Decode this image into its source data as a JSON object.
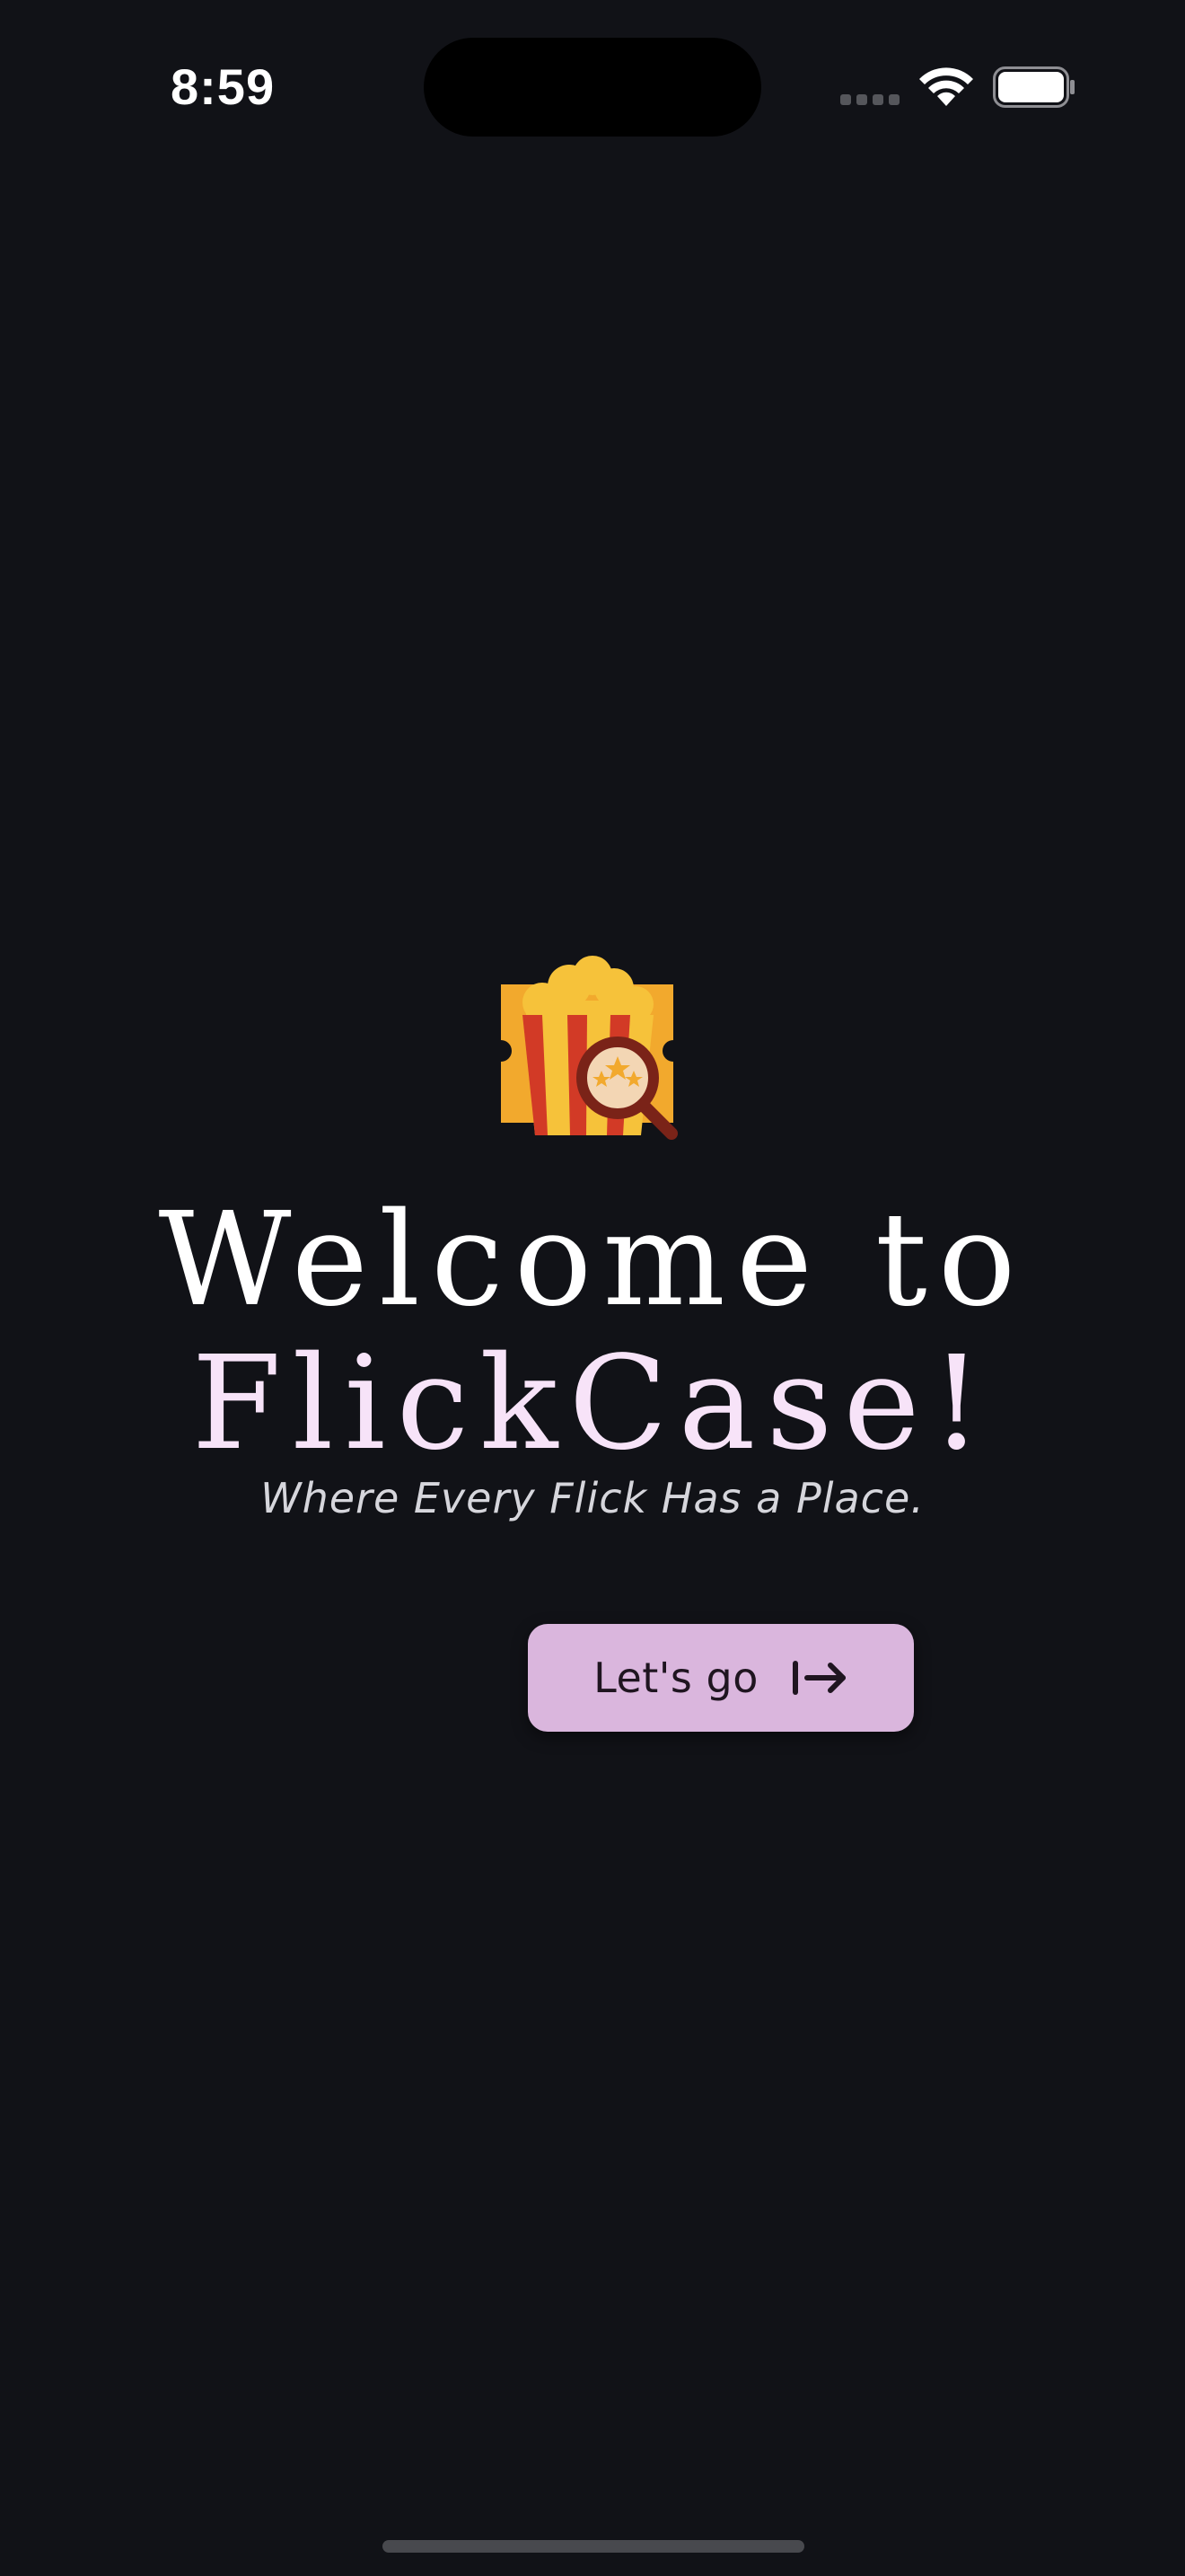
{
  "status_bar": {
    "time": "8:59",
    "icons": [
      "signal-icon",
      "wifi-icon",
      "battery-icon"
    ]
  },
  "welcome": {
    "line1": "Welcome to",
    "line2": "FlickCase!",
    "tagline": "Where Every Flick Has a Place."
  },
  "cta": {
    "label": "Let's go",
    "icon": "arrow-right-to-icon"
  },
  "colors": {
    "background": "#111217",
    "title": "#ffffff",
    "app_name": "#f7e3f8",
    "tagline": "#d6d6dc",
    "button_bg": "#dab6dd",
    "button_text": "#1f1520",
    "logo_ticket": "#f2a92d",
    "logo_popcorn": "#f6c23a",
    "logo_stripe_red": "#d23a26",
    "logo_magnifier": "#7a2318"
  }
}
